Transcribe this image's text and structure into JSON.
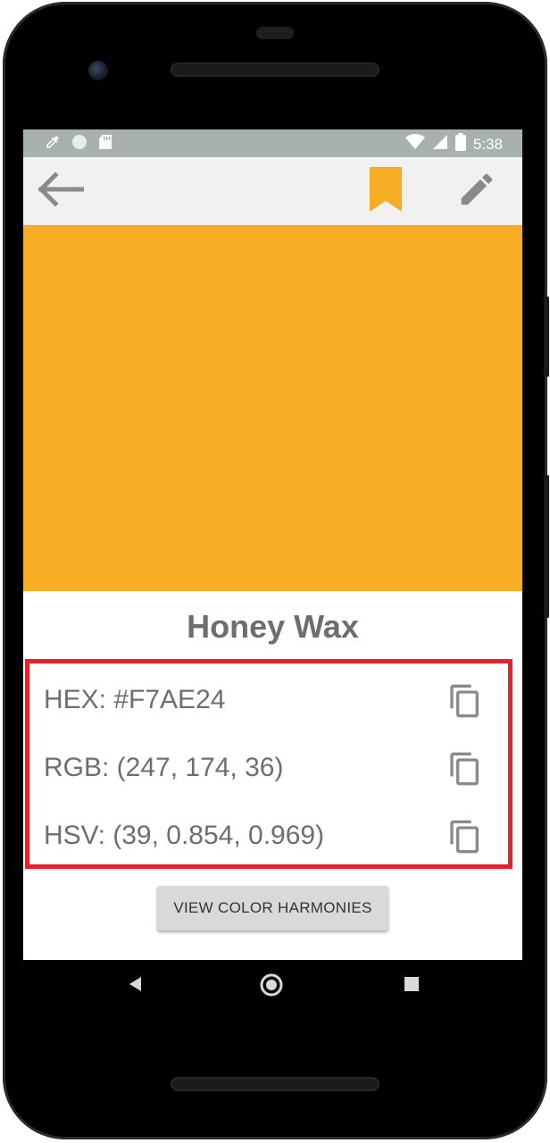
{
  "status_bar": {
    "time": "5:38",
    "icons_left": [
      "eyedropper-icon",
      "circle-icon",
      "sd-card-icon"
    ],
    "icons_right": [
      "wifi-icon",
      "signal-icon",
      "battery-icon"
    ]
  },
  "app_bar": {
    "back_icon": "arrow-back-icon",
    "bookmark_icon": "bookmark-icon",
    "edit_icon": "pencil-icon"
  },
  "color": {
    "name": "Honey Wax",
    "swatch_hex": "#F7AE24"
  },
  "values": {
    "hex": "HEX: #F7AE24",
    "rgb": "RGB: (247, 174, 36)",
    "hsv": "HSV: (39, 0.854, 0.969)"
  },
  "actions": {
    "view_harmonies_label": "VIEW COLOR HARMONIES"
  },
  "colors": {
    "accent": "#F7AE24",
    "status_bar": "#A7B1B0",
    "app_bar": "#F1F1F1",
    "text_gray": "#6E6E6E",
    "highlight_border": "#E8202A"
  },
  "nav_bar": {
    "icons": [
      "back-triangle-icon",
      "home-circle-icon",
      "recents-square-icon"
    ]
  }
}
